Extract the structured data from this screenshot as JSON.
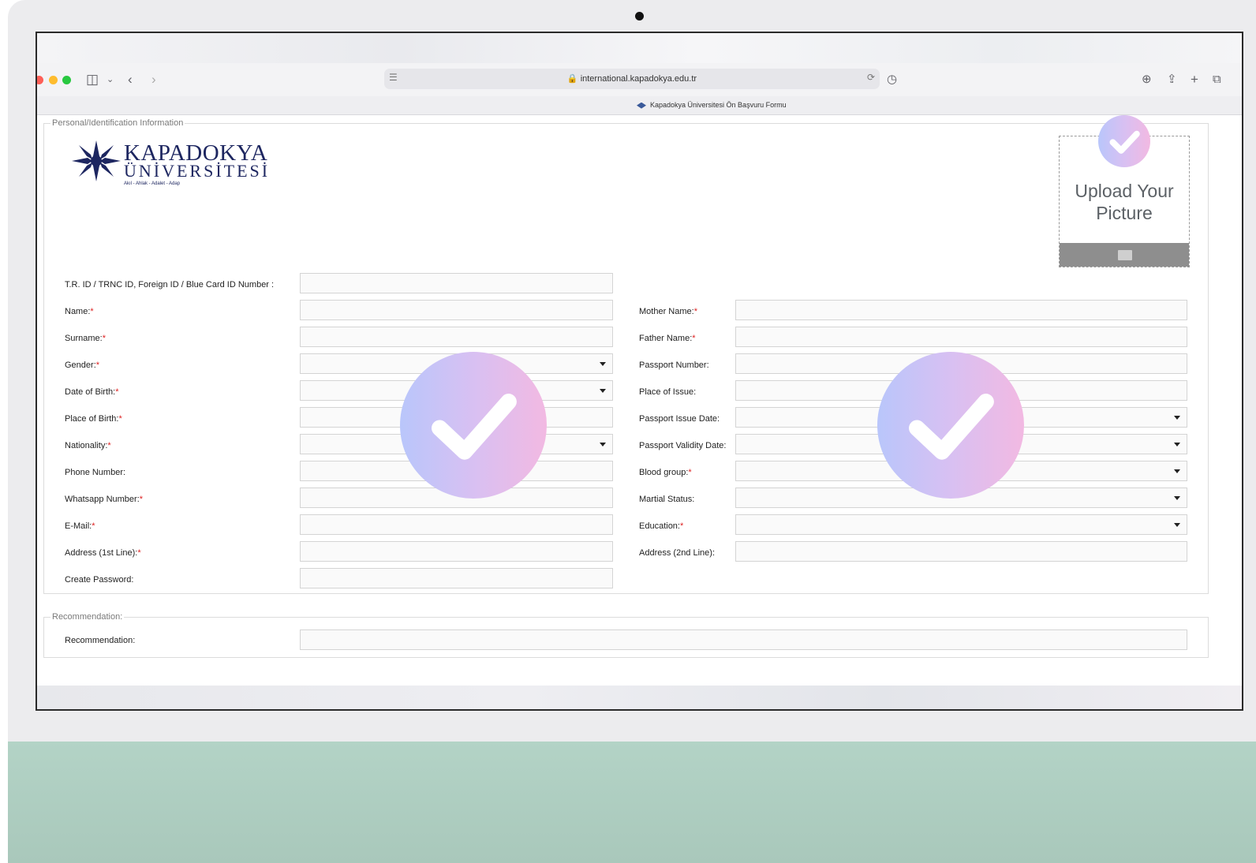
{
  "browser": {
    "url": "international.kapadokya.edu.tr",
    "tab_title": "Kapadokya Üniversitesi Ön Başvuru Formu"
  },
  "logo": {
    "name_line1": "KAPADOKYA",
    "name_line2": "ÜNİVERSİTESİ",
    "motto": "Akıl - Ahlak - Adalet - Adap"
  },
  "personal_section": {
    "legend": "Personal/Identification Information",
    "upload": {
      "label": "Upload Your Picture"
    },
    "left_fields": [
      {
        "label": "T.R. ID / TRNC ID, Foreign ID / Blue Card ID Number :",
        "required": false,
        "type": "text"
      },
      {
        "label": "Name:",
        "required": true,
        "type": "text"
      },
      {
        "label": "Surname:",
        "required": true,
        "type": "text"
      },
      {
        "label": "Gender:",
        "required": true,
        "type": "select"
      },
      {
        "label": "Date of Birth:",
        "required": true,
        "type": "select"
      },
      {
        "label": "Place of Birth:",
        "required": true,
        "type": "text"
      },
      {
        "label": "Nationality:",
        "required": true,
        "type": "select"
      },
      {
        "label": "Phone Number:",
        "required": false,
        "type": "text"
      },
      {
        "label": "Whatsapp Number:",
        "required": true,
        "type": "text"
      },
      {
        "label": "E-Mail:",
        "required": true,
        "type": "text"
      },
      {
        "label": "Address (1st Line):",
        "required": true,
        "type": "text"
      },
      {
        "label": "Create Password:",
        "required": false,
        "type": "password"
      }
    ],
    "right_fields": [
      {
        "label": "Mother Name:",
        "required": true,
        "type": "text"
      },
      {
        "label": "Father Name:",
        "required": true,
        "type": "text"
      },
      {
        "label": "Passport Number:",
        "required": false,
        "type": "text"
      },
      {
        "label": "Place of Issue:",
        "required": false,
        "type": "text"
      },
      {
        "label": "Passport Issue Date:",
        "required": false,
        "type": "select"
      },
      {
        "label": "Passport Validity Date:",
        "required": false,
        "type": "select"
      },
      {
        "label": "Blood group:",
        "required": true,
        "type": "select"
      },
      {
        "label": "Martial Status:",
        "required": false,
        "type": "select"
      },
      {
        "label": "Education:",
        "required": true,
        "type": "select"
      },
      {
        "label": "Address (2nd Line):",
        "required": false,
        "type": "text"
      }
    ]
  },
  "recommendation_section": {
    "legend": "Recommendation:",
    "field_label": "Recommendation:"
  },
  "colors": {
    "badge_gradient_start": "#b9c6fb",
    "badge_gradient_end": "#f2b9e2",
    "logo_navy": "#1d2660",
    "device_base": "#b3d3c6"
  }
}
